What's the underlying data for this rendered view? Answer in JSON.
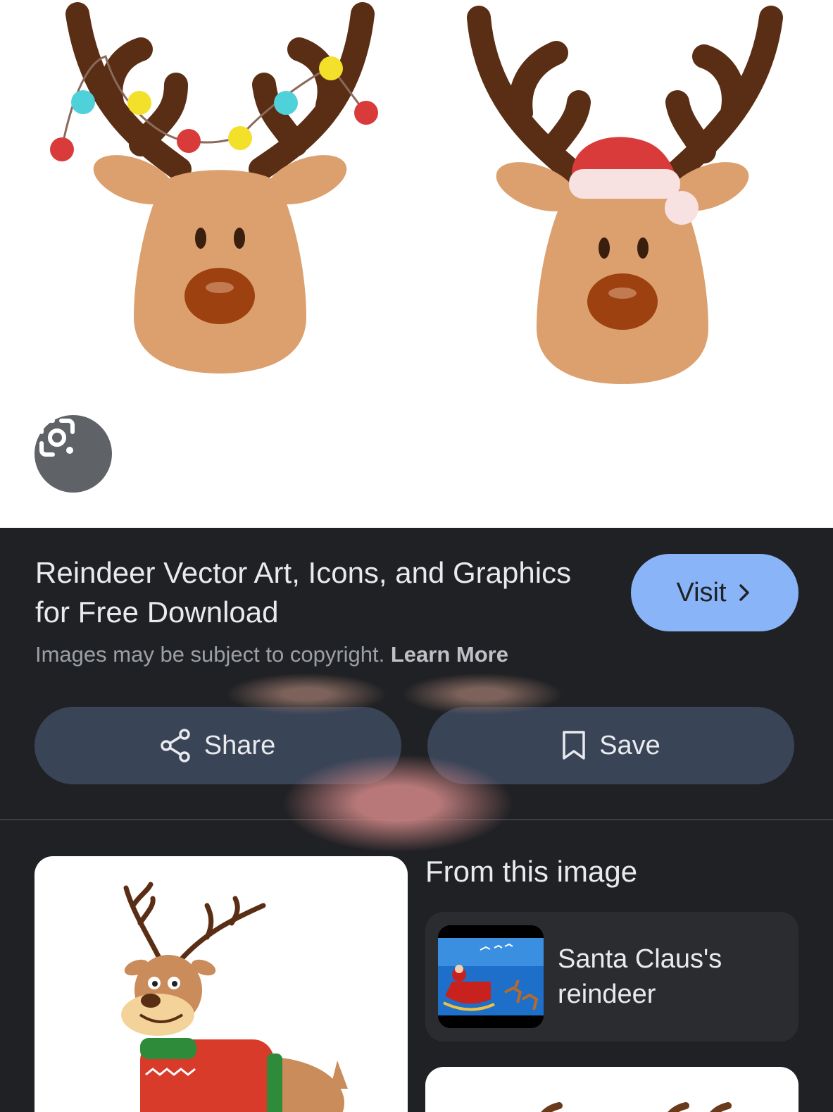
{
  "result": {
    "title": "Reindeer Vector Art, Icons, and Graphics for Free Download",
    "visit_label": "Visit",
    "copyright_text": "Images may be subject to copyright.",
    "learn_more_label": "Learn More"
  },
  "actions": {
    "share_label": "Share",
    "save_label": "Save"
  },
  "related": {
    "heading": "From this image",
    "items": [
      {
        "label": "Santa Claus's reindeer"
      }
    ]
  },
  "icons": {
    "lens": "google-lens-icon",
    "visit": "chevron-right-icon",
    "share": "share-icon",
    "save": "bookmark-icon"
  },
  "colors": {
    "panel_bg": "#202124",
    "visit_button": "#8ab4f8",
    "action_button": "#394457",
    "antler": "#5a2e14",
    "face": "#dca06e",
    "nose": "#9e4110"
  }
}
